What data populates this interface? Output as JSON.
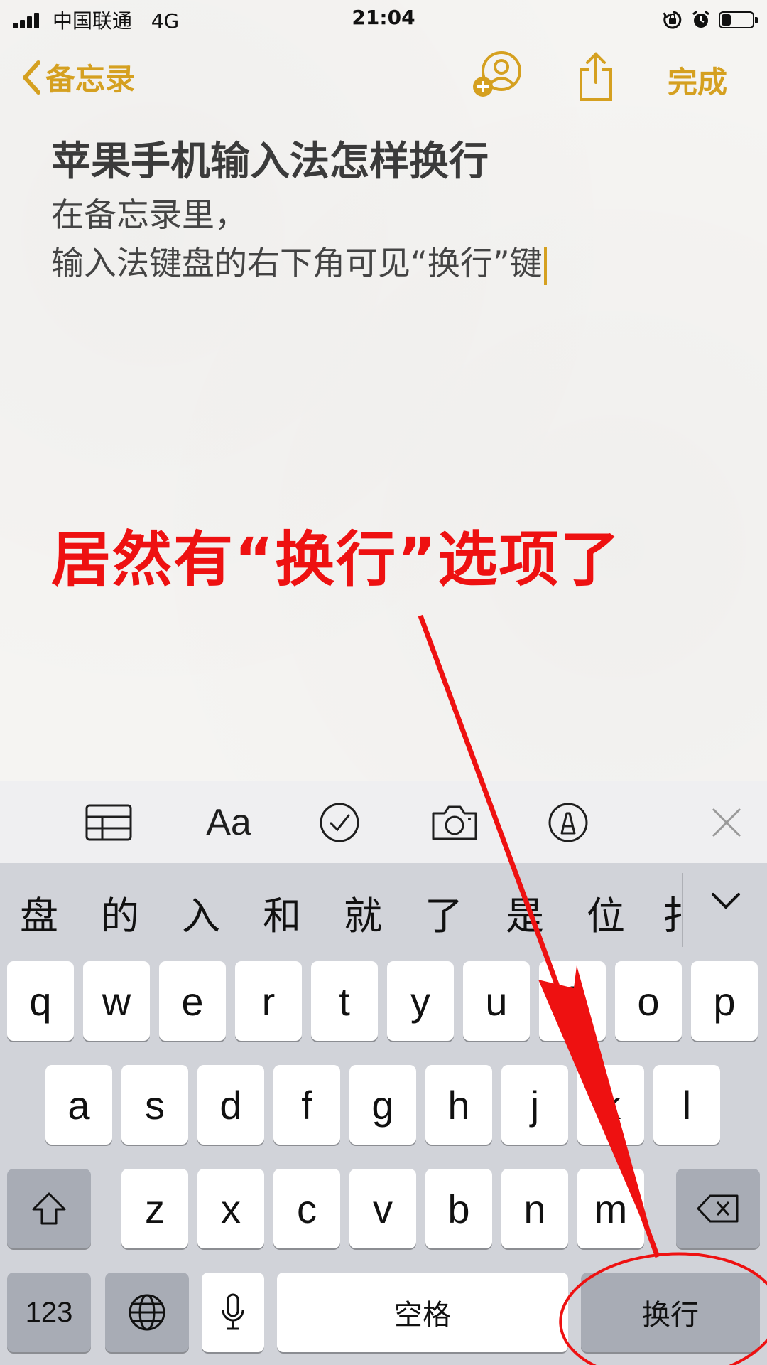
{
  "status_bar": {
    "carrier": "中国联通",
    "network": "4G",
    "time": "21:04",
    "battery_level": 0.3
  },
  "nav": {
    "back_label": "备忘录",
    "done_label": "完成",
    "accent_color": "#d5a020",
    "icons": [
      "chevron-left-icon",
      "add-person-icon",
      "share-icon"
    ]
  },
  "note": {
    "title": "苹果手机输入法怎样换行",
    "lines": [
      "在备忘录里，",
      "输入法键盘的右下角可见“换行”键"
    ]
  },
  "annotation": {
    "text": "居然有“换行”选项了",
    "color": "#ee1111"
  },
  "toolbar": {
    "text_format_label": "Aa",
    "icons": [
      "table-icon",
      "text-format-icon",
      "checklist-icon",
      "camera-icon",
      "markup-icon",
      "close-icon"
    ]
  },
  "keyboard": {
    "candidates": [
      "盘",
      "的",
      "入",
      "和",
      "就",
      "了",
      "是",
      "位",
      "扌"
    ],
    "row1": [
      "q",
      "w",
      "e",
      "r",
      "t",
      "y",
      "u",
      "i",
      "o",
      "p"
    ],
    "row2": [
      "a",
      "s",
      "d",
      "f",
      "g",
      "h",
      "j",
      "k",
      "l"
    ],
    "row3": [
      "z",
      "x",
      "c",
      "v",
      "b",
      "n",
      "m"
    ],
    "numbers_label": "123",
    "space_label": "空格",
    "return_label": "换行"
  }
}
